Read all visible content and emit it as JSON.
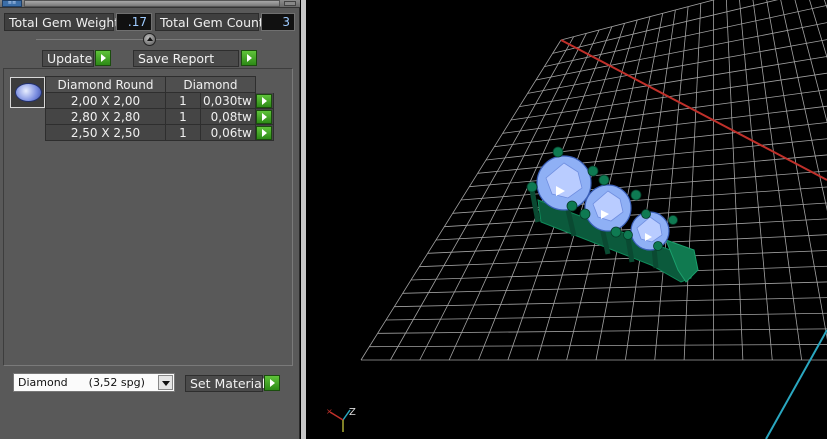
{
  "summary": {
    "weight_label": "Total Gem Weight",
    "weight_value": ".17",
    "count_label": "Total Gem Count",
    "count_value": "3"
  },
  "actions": {
    "update_label": "Update",
    "save_report_label": "Save Report"
  },
  "gem_table": {
    "header_shape": "Diamond Round",
    "header_material": "Diamond",
    "rows": [
      {
        "size": "2,00 X 2,00",
        "qty": "1",
        "weight": "0,030tw"
      },
      {
        "size": "2,80 X 2,80",
        "qty": "1",
        "weight": "0,08tw"
      },
      {
        "size": "2,50 X 2,50",
        "qty": "1",
        "weight": "0,06tw"
      }
    ]
  },
  "material": {
    "selected": "Diamond      (3,52 spg)",
    "set_label": "Set Material"
  },
  "viewport": {
    "axis_label": "Z",
    "grid_color": "#ffffff",
    "x_axis_color": "#c0302a",
    "y_axis_color": "#2aa7c0",
    "gem_color": "#9bb8ff",
    "prong_color": "#0d6a4a"
  },
  "icons": [
    "panel-menu-icon",
    "divider-collapse-icon",
    "go-arrow-icon",
    "gem-thumbnail-icon",
    "dropdown-arrow-icon",
    "axis-gizmo-icon"
  ]
}
